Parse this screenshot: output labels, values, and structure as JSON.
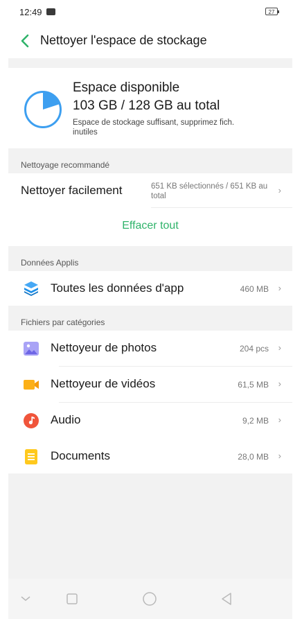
{
  "status_bar": {
    "time": "12:49",
    "battery": "27"
  },
  "header": {
    "title": "Nettoyer l'espace de stockage"
  },
  "storage": {
    "title": "Espace disponible",
    "value": "103 GB / 128 GB au total",
    "hint": "Espace de stockage suffisant, supprimez fich. inutiles",
    "used_fraction": 0.2
  },
  "recommended": {
    "section_label": "Nettoyage recommandé",
    "easy_clean_label": "Nettoyer facilement",
    "easy_clean_value": "651 KB sélectionnés / 651 KB au total",
    "clear_all_label": "Effacer tout"
  },
  "app_data": {
    "section_label": "Données Applis",
    "all_app_data_label": "Toutes les données d'app",
    "all_app_data_value": "460 MB"
  },
  "categories": {
    "section_label": "Fichiers par catégories",
    "items": [
      {
        "label": "Nettoyeur de photos",
        "value": "204 pcs",
        "icon": "image-icon"
      },
      {
        "label": "Nettoyeur de vidéos",
        "value": "61,5 MB",
        "icon": "video-icon"
      },
      {
        "label": "Audio",
        "value": "9,2 MB",
        "icon": "music-icon"
      },
      {
        "label": "Documents",
        "value": "28,0 MB",
        "icon": "document-icon"
      }
    ]
  },
  "colors": {
    "accent": "#2fb36a",
    "pie": "#3d9ff0",
    "app_data_icon": "#1e8fe8",
    "photo_icon": "#8d86f0",
    "video_icon": "#fcb017",
    "audio_icon": "#f0553b",
    "document_icon": "#ffc91d"
  },
  "chevron": "›"
}
